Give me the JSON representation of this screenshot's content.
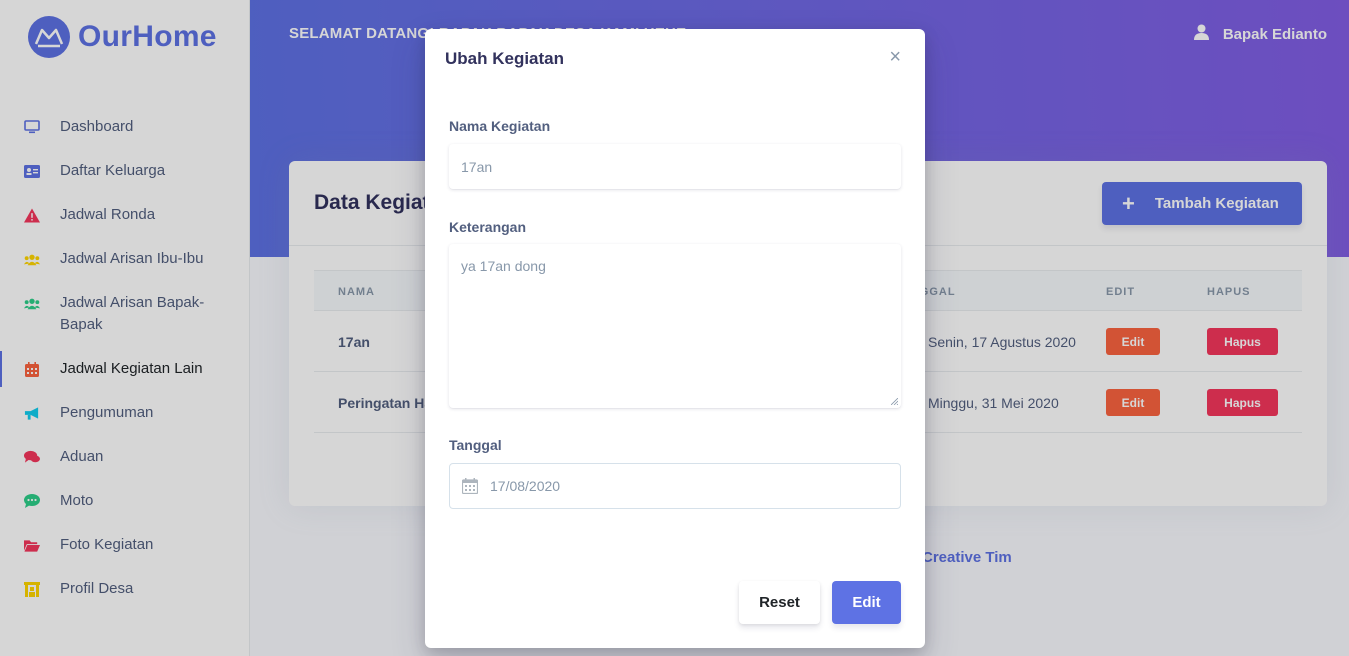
{
  "brand": {
    "name": "OurHome",
    "color": "#5e72e4"
  },
  "sidebar": {
    "items": [
      {
        "label": "Dashboard",
        "icon": "monitor-icon",
        "color": "#5e72e4"
      },
      {
        "label": "Daftar Keluarga",
        "icon": "id-card-icon",
        "color": "#5e72e4"
      },
      {
        "label": "Jadwal Ronda",
        "icon": "warning-icon",
        "color": "#f5365c"
      },
      {
        "label": "Jadwal Arisan Ibu-Ibu",
        "icon": "users-icon",
        "color": "#ffd600"
      },
      {
        "label": "Jadwal Arisan Bapak-Bapak",
        "icon": "users-icon",
        "color": "#2dce89"
      },
      {
        "label": "Jadwal Kegiatan Lain",
        "icon": "calendar-icon",
        "color": "#fb6340",
        "active": true
      },
      {
        "label": "Pengumuman",
        "icon": "megaphone-icon",
        "color": "#11cdef"
      },
      {
        "label": "Aduan",
        "icon": "comments-icon",
        "color": "#f5365c"
      },
      {
        "label": "Moto",
        "icon": "comment-dots-icon",
        "color": "#2dce89"
      },
      {
        "label": "Foto Kegiatan",
        "icon": "folder-open-icon",
        "color": "#f5365c"
      },
      {
        "label": "Profil Desa",
        "icon": "building-icon",
        "color": "#ffd600"
      }
    ]
  },
  "header": {
    "welcome": "SELAMAT DATANG! BAPAK BAPAK DESA KAMI HEHE",
    "user_name": "Bapak Edianto"
  },
  "card": {
    "title": "Data Kegiatan",
    "add_label": "Tambah Kegiatan",
    "columns": {
      "nama": "NAMA",
      "tanggal": "TANGGAL",
      "edit": "EDIT",
      "hapus": "HAPUS"
    },
    "rows": [
      {
        "nama": "17an",
        "tanggal": "Senin, 17 Agustus 2020",
        "edit": "Edit",
        "hapus": "Hapus"
      },
      {
        "nama": "Peringatan Hari Raya",
        "tanggal": "Minggu, 31 Mei 2020",
        "edit": "Edit",
        "hapus": "Hapus"
      }
    ]
  },
  "footer": {
    "link": "Creative Tim"
  },
  "modal": {
    "title": "Ubah Kegiatan",
    "close": "×",
    "nama_label": "Nama Kegiatan",
    "nama_value": "17an",
    "keterangan_label": "Keterangan",
    "keterangan_value": "ya 17an dong",
    "tanggal_label": "Tanggal",
    "tanggal_value": "17/08/2020",
    "reset_label": "Reset",
    "submit_label": "Edit"
  }
}
